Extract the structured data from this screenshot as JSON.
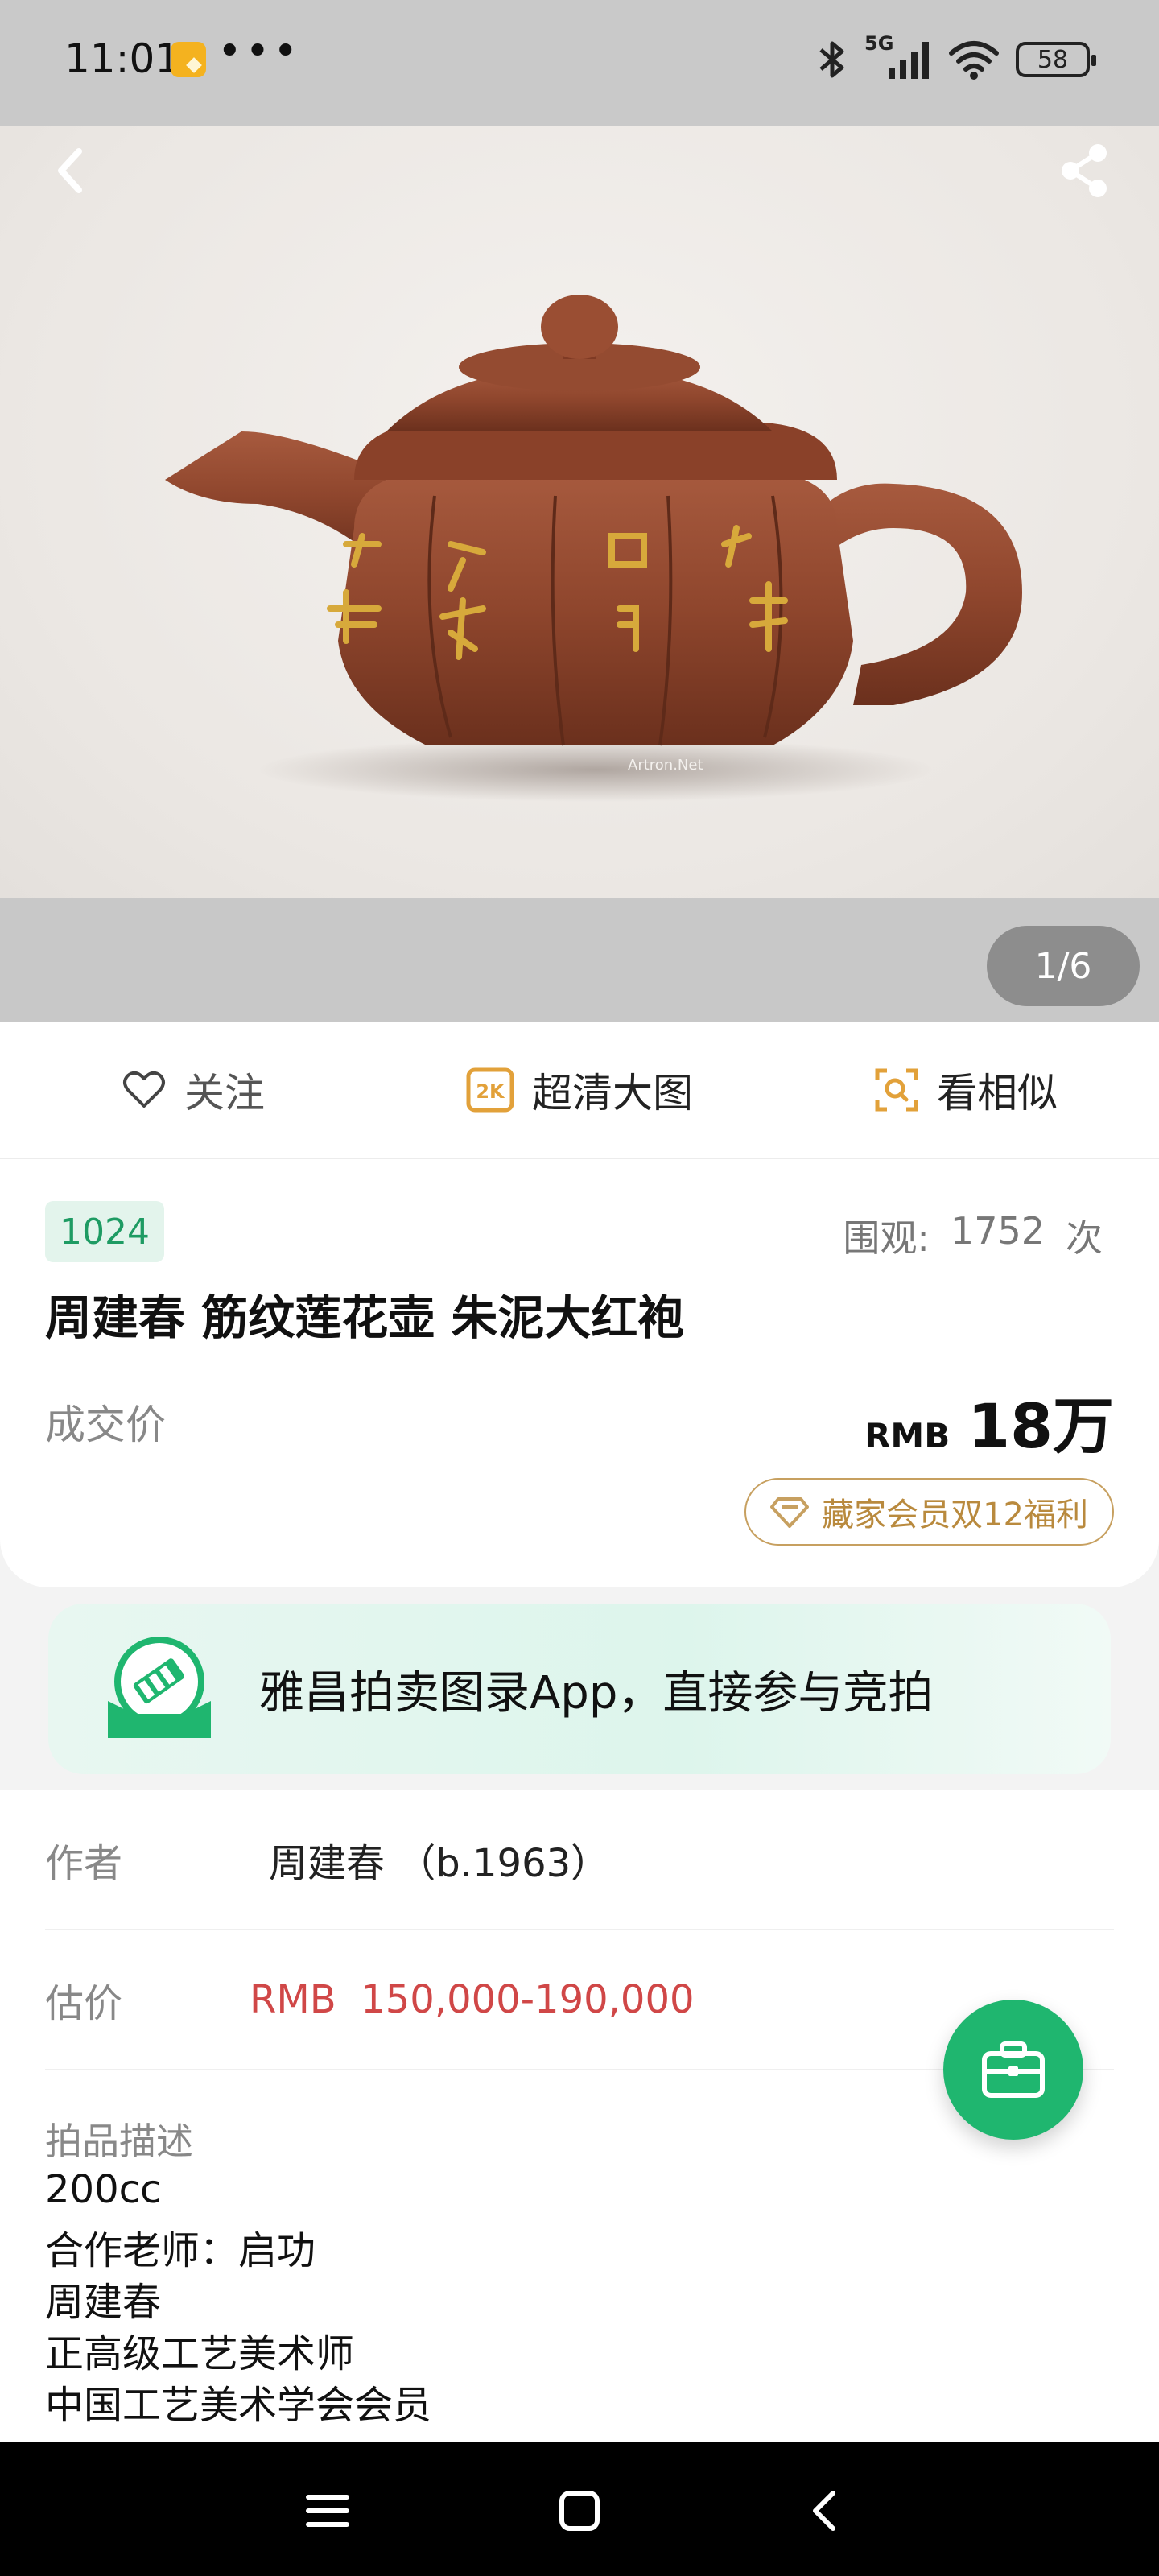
{
  "status_bar": {
    "time": "11:01",
    "dots": "•••",
    "network": "5G",
    "battery": "58"
  },
  "gallery": {
    "pager": "1/6",
    "watermark": "Artron.Net"
  },
  "actions": {
    "follow_label": "关注",
    "hd_label": "超清大图",
    "hd_badge": "2K",
    "similar_label": "看相似"
  },
  "lot": {
    "number": "1024",
    "views_label": "围观:",
    "views_count": "1752",
    "views_unit": "次",
    "title": "周建春 筋纹莲花壶 朱泥大红袍",
    "deal_label": "成交价",
    "price_currency": "RMB",
    "price_value": "18万",
    "vip_label": "藏家会员双12福利"
  },
  "banner": {
    "text": "雅昌拍卖图录App，直接参与竞拍"
  },
  "details": {
    "author_key": "作者",
    "author_value": "周建春 （b.1963）",
    "estimate_key": "估价",
    "estimate_value": "RMB  150,000-190,000",
    "desc_title": "拍品描述",
    "desc_lines": [
      "200cc",
      "合作老师：启功",
      "周建春",
      "正高级工艺美术师",
      "中国工艺美术学会会员"
    ]
  },
  "colors": {
    "accent_green": "#1fb66f",
    "badge_green": "#1e9b63",
    "estimate_red": "#d04747",
    "vip_gold": "#b98a3e",
    "action_orange": "#e2a13a"
  }
}
